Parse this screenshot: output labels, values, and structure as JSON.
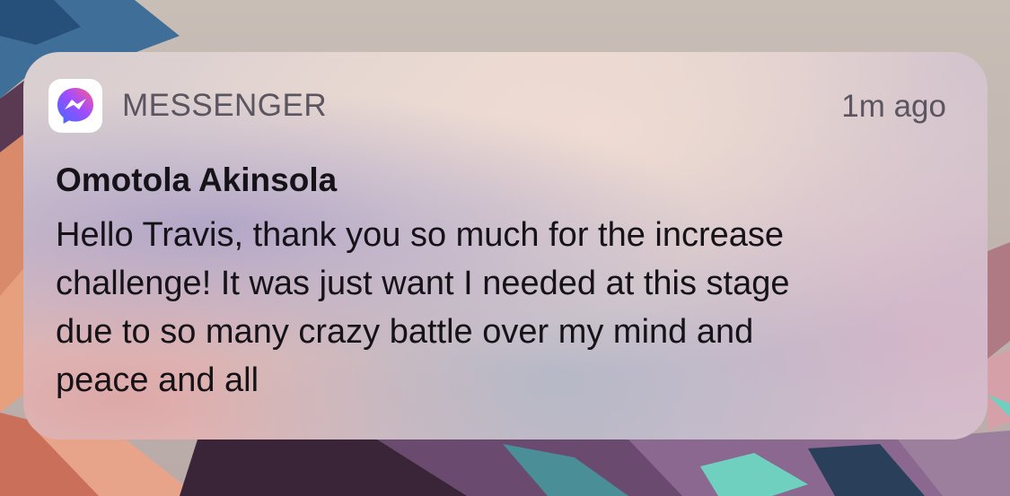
{
  "notification": {
    "app_icon": "messenger-icon",
    "app_name": "MESSENGER",
    "timestamp": "1m ago",
    "sender": "Omotola Akinsola",
    "message": "Hello Travis, thank you so much for the increase\nchallenge! It was just want I needed at this stage\ndue to so many crazy battle over my mind and\npeace and all"
  },
  "colors": {
    "messenger_gradient_start": "#4f6bff",
    "messenger_gradient_end": "#ff4fa0",
    "text_primary": "#151218",
    "text_secondary": "#5b5560"
  }
}
